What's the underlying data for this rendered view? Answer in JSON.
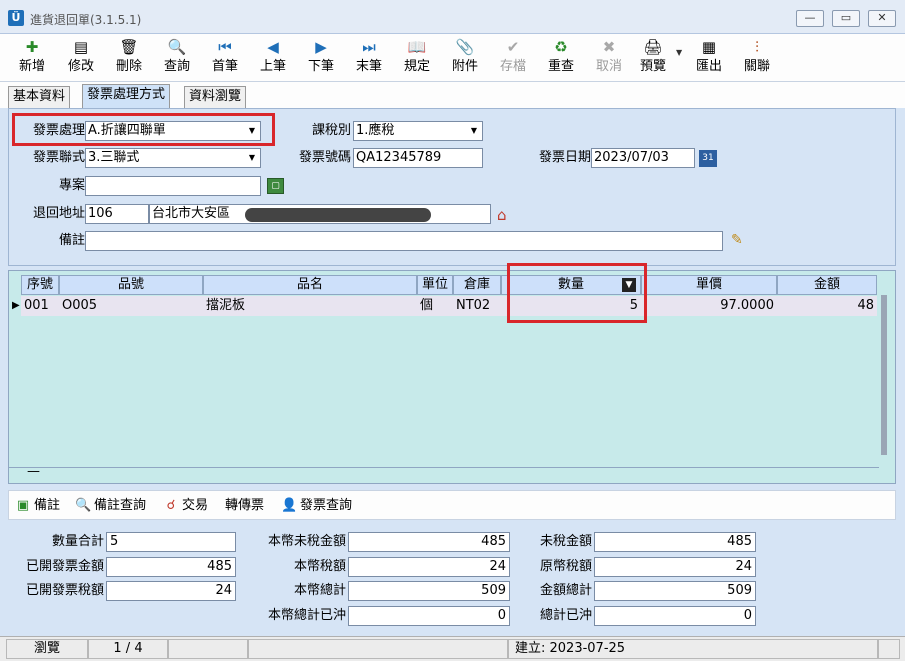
{
  "window": {
    "title": "進貨退回單(3.1.5.1)",
    "app_icon_letter": "Ü"
  },
  "toolbar": {
    "buttons": [
      {
        "label": "新增",
        "icon": "new-icon",
        "glyph": "✚"
      },
      {
        "label": "修改",
        "icon": "edit-icon",
        "glyph": "▤"
      },
      {
        "label": "刪除",
        "icon": "delete-icon",
        "glyph": "🗑"
      },
      {
        "label": "查詢",
        "icon": "search-icon",
        "glyph": "🔍"
      },
      {
        "label": "首筆",
        "icon": "first-icon",
        "glyph": "⏮"
      },
      {
        "label": "上筆",
        "icon": "prev-icon",
        "glyph": "◀"
      },
      {
        "label": "下筆",
        "icon": "next-icon",
        "glyph": "▶"
      },
      {
        "label": "末筆",
        "icon": "last-icon",
        "glyph": "⏭"
      },
      {
        "label": "規定",
        "icon": "rules-icon",
        "glyph": "📖"
      },
      {
        "label": "附件",
        "icon": "attachment-icon",
        "glyph": "📎"
      },
      {
        "label": "存檔",
        "icon": "save-icon",
        "glyph": "✔"
      },
      {
        "label": "重查",
        "icon": "refresh-icon",
        "glyph": "♻"
      },
      {
        "label": "取消",
        "icon": "cancel-icon",
        "glyph": "✖"
      },
      {
        "label": "預覽",
        "icon": "preview-icon",
        "glyph": "🖨"
      },
      {
        "label": "匯出",
        "icon": "export-icon",
        "glyph": "▦"
      },
      {
        "label": "關聯",
        "icon": "relation-icon",
        "glyph": "⫶"
      }
    ]
  },
  "tabs": [
    "基本資料",
    "發票處理方式",
    "資料瀏覽"
  ],
  "form": {
    "invoice_handling_label": "發票處理",
    "invoice_handling_value": "A.折讓四聯單",
    "tax_type_label": "課稅別",
    "tax_type_value": "1.應稅",
    "invoice_copies_label": "發票聯式",
    "invoice_copies_value": "3.三聯式",
    "invoice_no_label": "發票號碼",
    "invoice_no_value": "QA12345789",
    "invoice_date_label": "發票日期",
    "invoice_date_value": "2023/07/03",
    "project_label": "專案",
    "project_value": "",
    "return_address_label": "退回地址",
    "zip_value": "106",
    "address_value": "台北市大安區",
    "note_label": "備註",
    "note_value": "",
    "calendar_icon_text": "31"
  },
  "grid": {
    "columns": [
      "序號",
      "品號",
      "品名",
      "單位",
      "倉庫",
      "數量",
      "單價",
      "金額"
    ],
    "rows": [
      {
        "seq": "001",
        "item_no": "O005",
        "item_name": "擋泥板",
        "unit": "個",
        "warehouse": "NT02",
        "qty": "5",
        "unit_price": "97.0000",
        "amount": "48"
      }
    ],
    "footer_mark": "—"
  },
  "bottombar": {
    "items": [
      {
        "label": "備註",
        "icon": "note-icon"
      },
      {
        "label": "備註查詢",
        "icon": "note-search-icon"
      },
      {
        "label": "交易",
        "icon": "transaction-icon"
      },
      {
        "label": "轉傳票",
        "icon": ""
      },
      {
        "label": "發票查詢",
        "icon": "invoice-search-icon"
      }
    ]
  },
  "totals": {
    "qty_total_label": "數量合計",
    "qty_total_value": "5",
    "issued_invoice_amount_label": "已開發票金額",
    "issued_invoice_amount_value": "485",
    "issued_invoice_tax_label": "已開發票稅額",
    "issued_invoice_tax_value": "24",
    "local_pretax_label": "本幣未稅金額",
    "local_pretax_value": "485",
    "local_tax_label": "本幣稅額",
    "local_tax_value": "24",
    "local_total_label": "本幣總計",
    "local_total_value": "509",
    "local_total_offset_label": "本幣總計已沖",
    "local_total_offset_value": "0",
    "pretax_label": "未稅金額",
    "pretax_value": "485",
    "orig_tax_label": "原幣稅額",
    "orig_tax_value": "24",
    "amount_total_label": "金額總計",
    "amount_total_value": "509",
    "total_offset_label": "總計已沖",
    "total_offset_value": "0"
  },
  "status": {
    "mode": "瀏覽",
    "record": "1 / 4",
    "created": "建立: 2023-07-25"
  },
  "colors": {
    "highlight": "#d9262b",
    "panel_bg": "#d6e4f5",
    "grid_bg": "#c7eaea"
  }
}
